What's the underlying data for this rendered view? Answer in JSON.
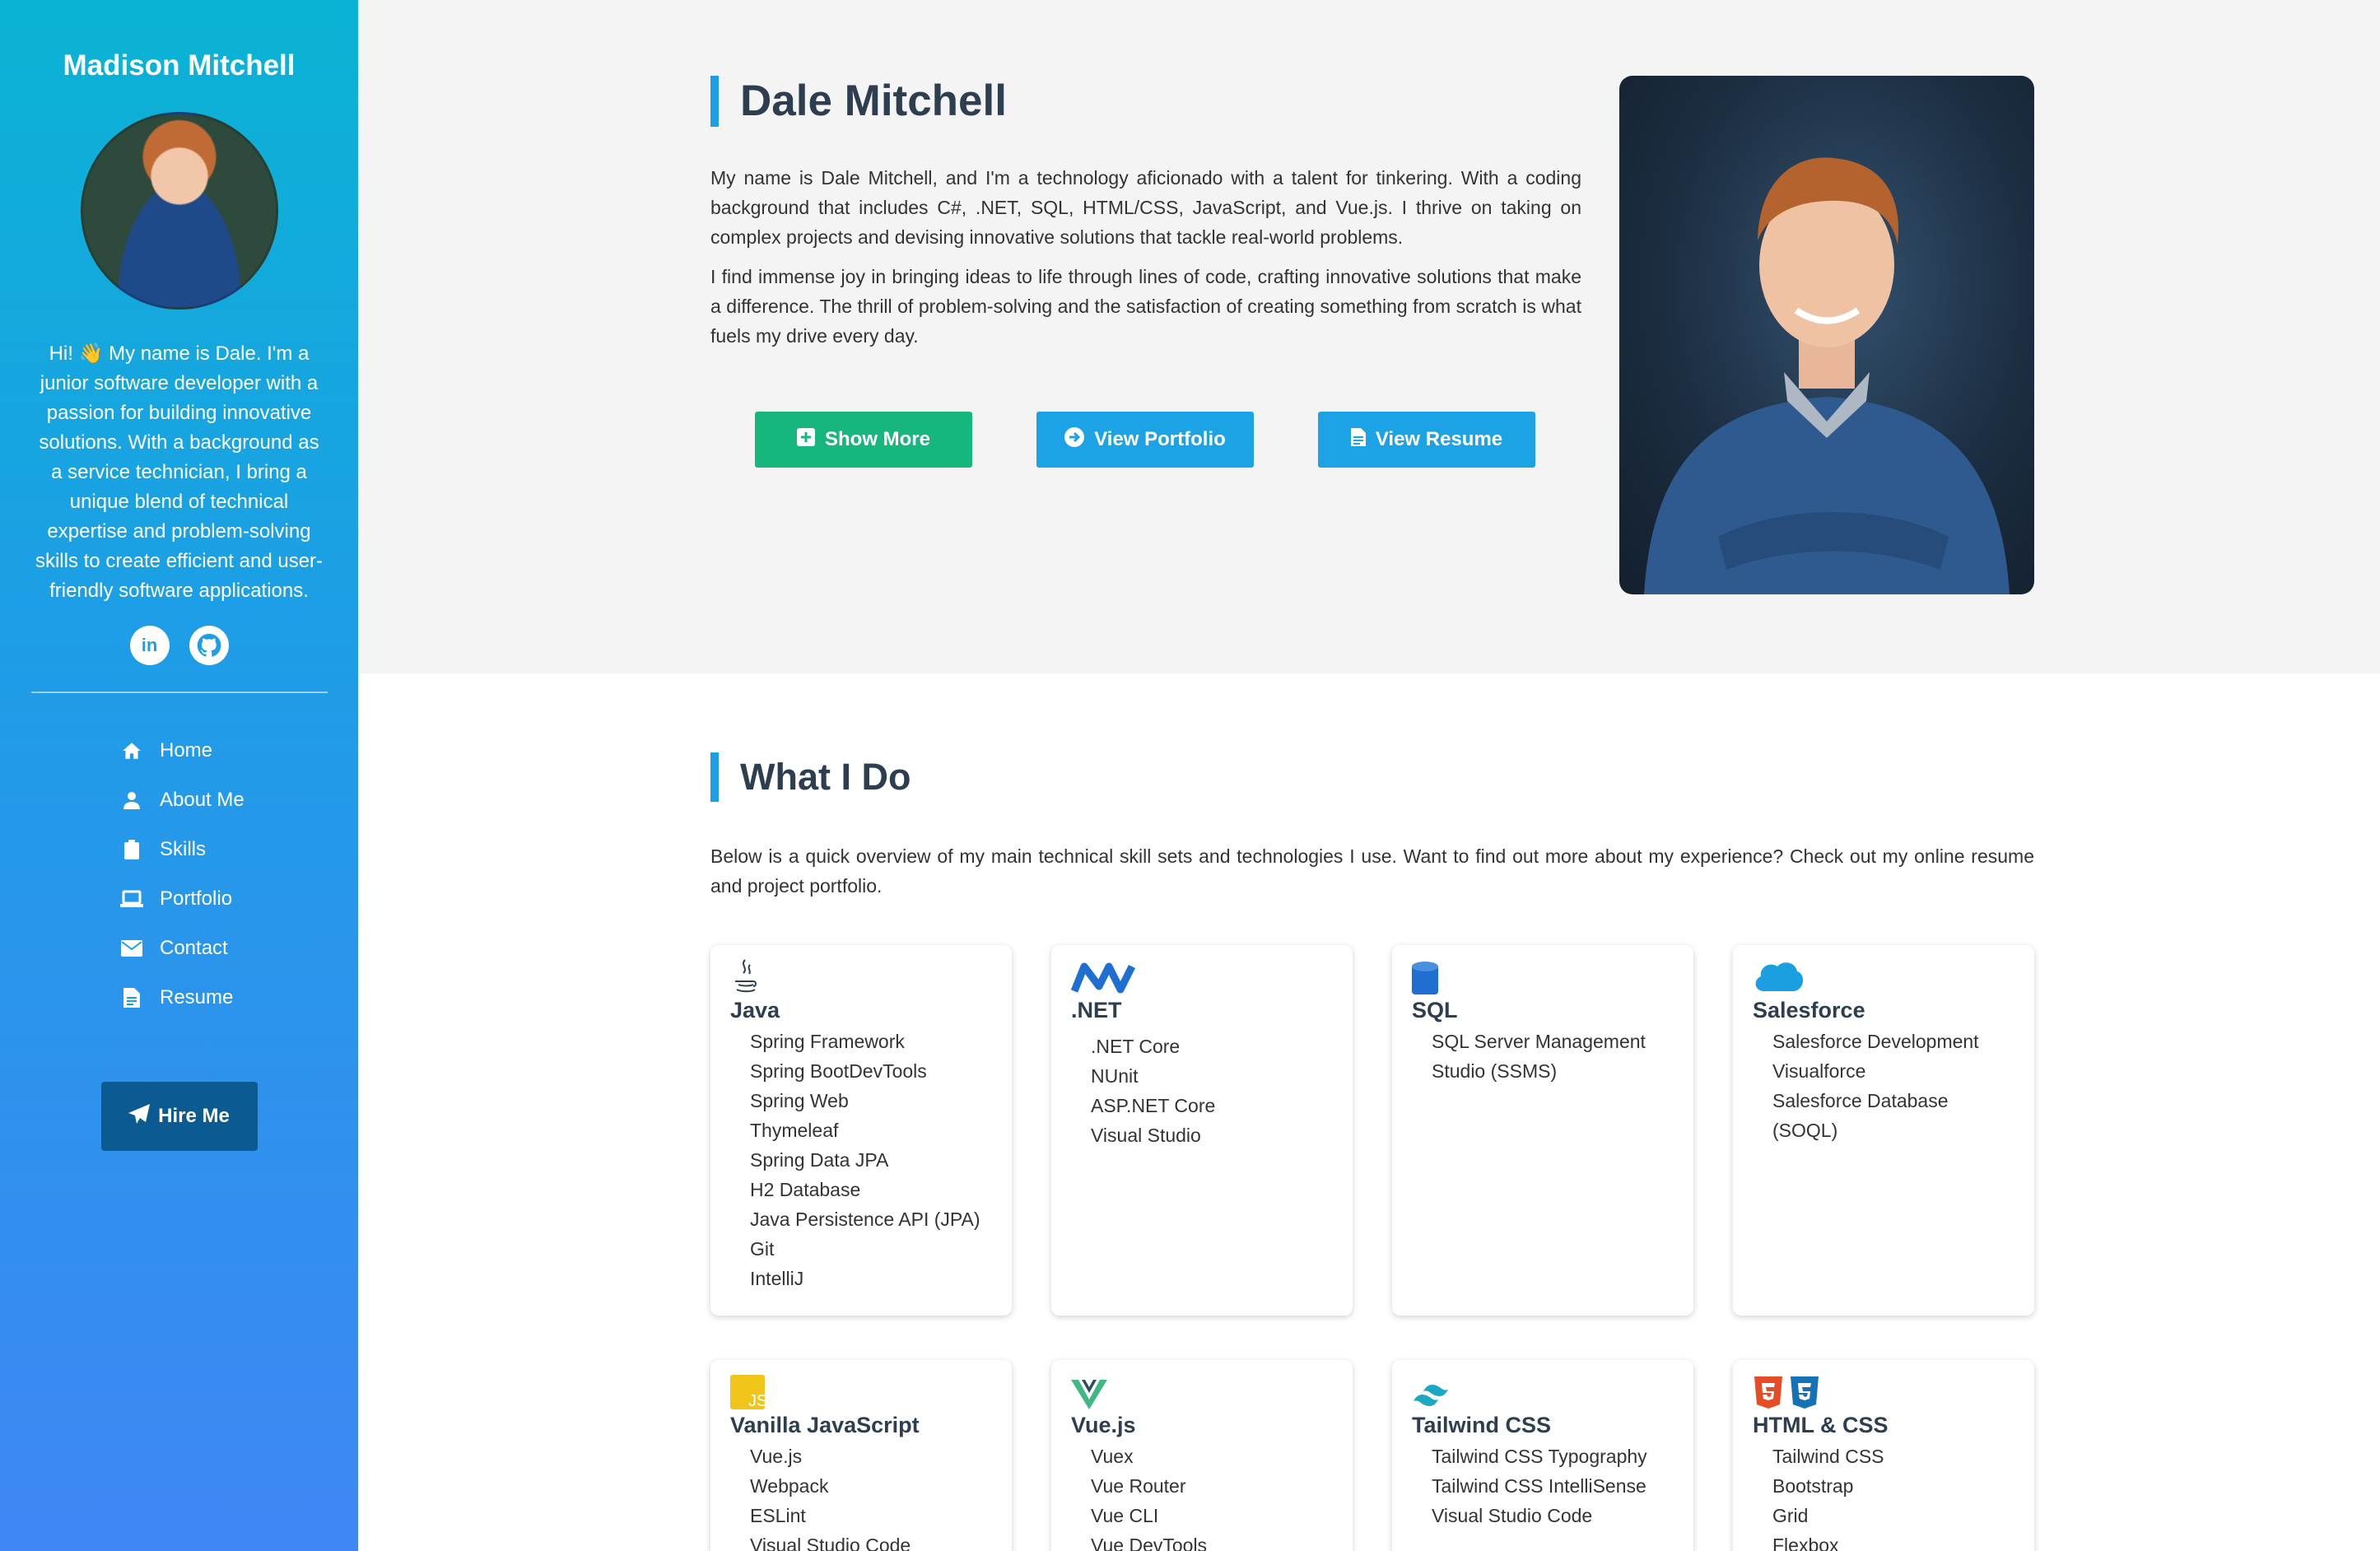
{
  "sidebar": {
    "name": "Madison Mitchell",
    "bio": "Hi! 👋 My name is Dale. I'm a junior software developer with a passion for building innovative solutions. With a background as a service technician, I bring a unique blend of technical expertise and problem-solving skills to create efficient and user-friendly software applications.",
    "socials": [
      {
        "icon": "linkedin-icon",
        "label": "in"
      },
      {
        "icon": "github-icon",
        "label": ""
      }
    ],
    "nav": [
      {
        "label": "Home",
        "icon": "home-icon"
      },
      {
        "label": "About Me",
        "icon": "user-icon"
      },
      {
        "label": "Skills",
        "icon": "clipboard-icon"
      },
      {
        "label": "Portfolio",
        "icon": "laptop-icon"
      },
      {
        "label": "Contact",
        "icon": "envelope-icon"
      },
      {
        "label": "Resume",
        "icon": "file-icon"
      }
    ],
    "hire_label": "Hire Me"
  },
  "hero": {
    "title": "Dale Mitchell",
    "paragraph1": "My name is Dale Mitchell, and I'm a technology aficionado with a talent for tinkering. With a coding background that includes C#, .NET, SQL, HTML/CSS, JavaScript, and Vue.js. I thrive on taking on complex projects and devising innovative solutions that tackle real-world problems.",
    "paragraph2": "I find immense joy in bringing ideas to life through lines of code, crafting innovative solutions that make a difference. The thrill of problem-solving and the satisfaction of creating something from scratch is what fuels my drive every day.",
    "buttons": {
      "show_more": "Show More",
      "view_portfolio": "View Portfolio",
      "view_resume": "View Resume"
    }
  },
  "what_i_do": {
    "title": "What I Do",
    "intro": "Below is a quick overview of my main technical skill sets and technologies I use. Want to find out more about my experience? Check out my online resume and project portfolio.",
    "cards": [
      {
        "title": "Java",
        "icon": "java-icon",
        "items": [
          "Spring Framework",
          "Spring BootDevTools",
          "Spring Web",
          "Thymeleaf",
          "Spring Data JPA",
          "H2 Database",
          "Java Persistence API (JPA)",
          "Git",
          "IntelliJ"
        ]
      },
      {
        "title": ".NET",
        "icon": "dotnet-icon",
        "items": [
          ".NET Core",
          "NUnit",
          "ASP.NET Core",
          "Visual Studio"
        ]
      },
      {
        "title": "SQL",
        "icon": "database-icon",
        "items": [
          "SQL Server Management Studio (SSMS)"
        ]
      },
      {
        "title": "Salesforce",
        "icon": "salesforce-icon",
        "items": [
          "Salesforce Development",
          "Visualforce",
          "Salesforce Database (SOQL)"
        ]
      },
      {
        "title": "Vanilla JavaScript",
        "icon": "javascript-icon",
        "items": [
          "Vue.js",
          "Webpack",
          "ESLint",
          "Visual Studio Code"
        ]
      },
      {
        "title": "Vue.js",
        "icon": "vue-icon",
        "items": [
          "Vuex",
          "Vue Router",
          "Vue CLI",
          "Vue DevTools"
        ]
      },
      {
        "title": "Tailwind CSS",
        "icon": "tailwind-icon",
        "items": [
          "Tailwind CSS Typography",
          "Tailwind CSS IntelliSense",
          "Visual Studio Code"
        ]
      },
      {
        "title": "HTML & CSS",
        "icon": "html-css-icon",
        "items": [
          "Tailwind CSS",
          "Bootstrap",
          "Grid",
          "Flexbox"
        ]
      }
    ]
  }
}
